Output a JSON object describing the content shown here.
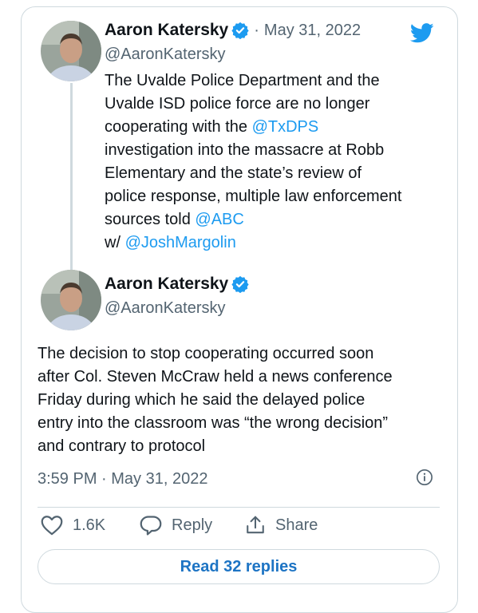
{
  "tweets": [
    {
      "author_name": "Aaron Katersky",
      "handle": "@AaronKatersky",
      "separator": "·",
      "date": "May 31, 2022",
      "lines": [
        [
          {
            "t": "The Uvalde Police Department and the"
          }
        ],
        [
          {
            "t": "Uvalde ISD police force are no longer"
          }
        ],
        [
          {
            "t": "cooperating with the "
          },
          {
            "t": "@TxDPS",
            "m": true
          }
        ],
        [
          {
            "t": "investigation into the massacre at Robb"
          }
        ],
        [
          {
            "t": "Elementary and the state’s review of"
          }
        ],
        [
          {
            "t": "police response, multiple law enforcement"
          }
        ],
        [
          {
            "t": "sources told "
          },
          {
            "t": "@ABC",
            "m": true
          }
        ],
        [
          {
            "t": "w/ "
          },
          {
            "t": "@JoshMargolin",
            "m": true
          }
        ]
      ]
    },
    {
      "author_name": "Aaron Katersky",
      "handle": "@AaronKatersky",
      "lines": [
        [
          {
            "t": "The decision to stop cooperating occurred soon"
          }
        ],
        [
          {
            "t": "after Col. Steven McCraw held a news conference"
          }
        ],
        [
          {
            "t": "Friday during which he said the delayed police"
          }
        ],
        [
          {
            "t": "entry into the classroom was “the wrong decision”"
          }
        ],
        [
          {
            "t": "and contrary to protocol"
          }
        ]
      ],
      "timestamp": "3:59 PM · May 31, 2022"
    }
  ],
  "actions": {
    "like_count": "1.6K",
    "reply_label": "Reply",
    "share_label": "Share"
  },
  "read_replies_label": "Read 32 replies",
  "icons": {
    "brand": "twitter-bird-icon",
    "verified": "verified-badge-icon",
    "info": "info-icon",
    "like": "heart-icon",
    "reply": "speech-bubble-icon",
    "share": "share-upload-icon"
  },
  "colors": {
    "link": "#1d9bf0",
    "twitter_blue": "#1d9bf0",
    "text": "#0f1419",
    "muted": "#536471",
    "border": "#cfd9de",
    "button_text": "#1d74c4"
  }
}
